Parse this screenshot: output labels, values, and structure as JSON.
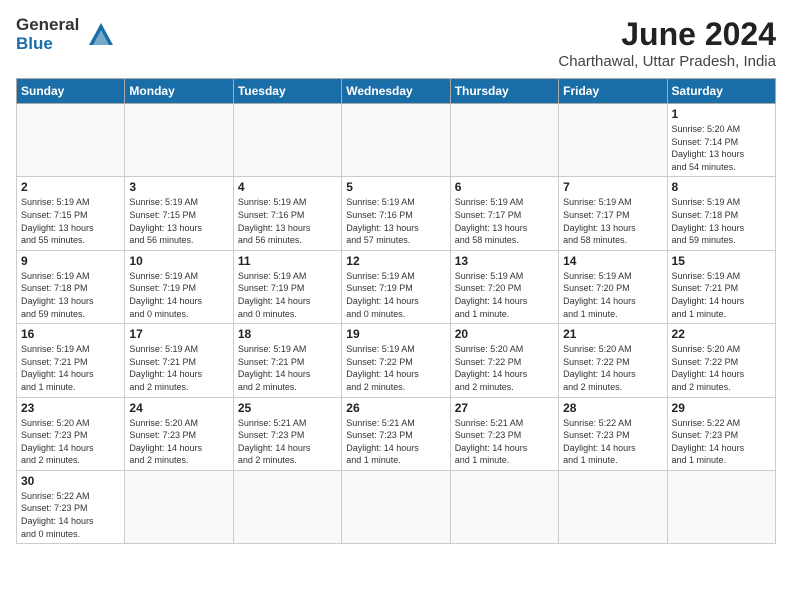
{
  "header": {
    "logo_general": "General",
    "logo_blue": "Blue",
    "month": "June 2024",
    "location": "Charthawal, Uttar Pradesh, India"
  },
  "days_of_week": [
    "Sunday",
    "Monday",
    "Tuesday",
    "Wednesday",
    "Thursday",
    "Friday",
    "Saturday"
  ],
  "weeks": [
    [
      {
        "day": "",
        "info": ""
      },
      {
        "day": "",
        "info": ""
      },
      {
        "day": "",
        "info": ""
      },
      {
        "day": "",
        "info": ""
      },
      {
        "day": "",
        "info": ""
      },
      {
        "day": "",
        "info": ""
      },
      {
        "day": "1",
        "info": "Sunrise: 5:20 AM\nSunset: 7:14 PM\nDaylight: 13 hours\nand 54 minutes."
      }
    ],
    [
      {
        "day": "2",
        "info": "Sunrise: 5:19 AM\nSunset: 7:15 PM\nDaylight: 13 hours\nand 55 minutes."
      },
      {
        "day": "3",
        "info": "Sunrise: 5:19 AM\nSunset: 7:15 PM\nDaylight: 13 hours\nand 56 minutes."
      },
      {
        "day": "4",
        "info": "Sunrise: 5:19 AM\nSunset: 7:16 PM\nDaylight: 13 hours\nand 56 minutes."
      },
      {
        "day": "5",
        "info": "Sunrise: 5:19 AM\nSunset: 7:16 PM\nDaylight: 13 hours\nand 57 minutes."
      },
      {
        "day": "6",
        "info": "Sunrise: 5:19 AM\nSunset: 7:17 PM\nDaylight: 13 hours\nand 58 minutes."
      },
      {
        "day": "7",
        "info": "Sunrise: 5:19 AM\nSunset: 7:17 PM\nDaylight: 13 hours\nand 58 minutes."
      },
      {
        "day": "8",
        "info": "Sunrise: 5:19 AM\nSunset: 7:18 PM\nDaylight: 13 hours\nand 59 minutes."
      }
    ],
    [
      {
        "day": "9",
        "info": "Sunrise: 5:19 AM\nSunset: 7:18 PM\nDaylight: 13 hours\nand 59 minutes."
      },
      {
        "day": "10",
        "info": "Sunrise: 5:19 AM\nSunset: 7:19 PM\nDaylight: 14 hours\nand 0 minutes."
      },
      {
        "day": "11",
        "info": "Sunrise: 5:19 AM\nSunset: 7:19 PM\nDaylight: 14 hours\nand 0 minutes."
      },
      {
        "day": "12",
        "info": "Sunrise: 5:19 AM\nSunset: 7:19 PM\nDaylight: 14 hours\nand 0 minutes."
      },
      {
        "day": "13",
        "info": "Sunrise: 5:19 AM\nSunset: 7:20 PM\nDaylight: 14 hours\nand 1 minute."
      },
      {
        "day": "14",
        "info": "Sunrise: 5:19 AM\nSunset: 7:20 PM\nDaylight: 14 hours\nand 1 minute."
      },
      {
        "day": "15",
        "info": "Sunrise: 5:19 AM\nSunset: 7:21 PM\nDaylight: 14 hours\nand 1 minute."
      }
    ],
    [
      {
        "day": "16",
        "info": "Sunrise: 5:19 AM\nSunset: 7:21 PM\nDaylight: 14 hours\nand 1 minute."
      },
      {
        "day": "17",
        "info": "Sunrise: 5:19 AM\nSunset: 7:21 PM\nDaylight: 14 hours\nand 2 minutes."
      },
      {
        "day": "18",
        "info": "Sunrise: 5:19 AM\nSunset: 7:21 PM\nDaylight: 14 hours\nand 2 minutes."
      },
      {
        "day": "19",
        "info": "Sunrise: 5:19 AM\nSunset: 7:22 PM\nDaylight: 14 hours\nand 2 minutes."
      },
      {
        "day": "20",
        "info": "Sunrise: 5:20 AM\nSunset: 7:22 PM\nDaylight: 14 hours\nand 2 minutes."
      },
      {
        "day": "21",
        "info": "Sunrise: 5:20 AM\nSunset: 7:22 PM\nDaylight: 14 hours\nand 2 minutes."
      },
      {
        "day": "22",
        "info": "Sunrise: 5:20 AM\nSunset: 7:22 PM\nDaylight: 14 hours\nand 2 minutes."
      }
    ],
    [
      {
        "day": "23",
        "info": "Sunrise: 5:20 AM\nSunset: 7:23 PM\nDaylight: 14 hours\nand 2 minutes."
      },
      {
        "day": "24",
        "info": "Sunrise: 5:20 AM\nSunset: 7:23 PM\nDaylight: 14 hours\nand 2 minutes."
      },
      {
        "day": "25",
        "info": "Sunrise: 5:21 AM\nSunset: 7:23 PM\nDaylight: 14 hours\nand 2 minutes."
      },
      {
        "day": "26",
        "info": "Sunrise: 5:21 AM\nSunset: 7:23 PM\nDaylight: 14 hours\nand 1 minute."
      },
      {
        "day": "27",
        "info": "Sunrise: 5:21 AM\nSunset: 7:23 PM\nDaylight: 14 hours\nand 1 minute."
      },
      {
        "day": "28",
        "info": "Sunrise: 5:22 AM\nSunset: 7:23 PM\nDaylight: 14 hours\nand 1 minute."
      },
      {
        "day": "29",
        "info": "Sunrise: 5:22 AM\nSunset: 7:23 PM\nDaylight: 14 hours\nand 1 minute."
      }
    ],
    [
      {
        "day": "30",
        "info": "Sunrise: 5:22 AM\nSunset: 7:23 PM\nDaylight: 14 hours\nand 0 minutes."
      },
      {
        "day": "",
        "info": ""
      },
      {
        "day": "",
        "info": ""
      },
      {
        "day": "",
        "info": ""
      },
      {
        "day": "",
        "info": ""
      },
      {
        "day": "",
        "info": ""
      },
      {
        "day": "",
        "info": ""
      }
    ]
  ]
}
